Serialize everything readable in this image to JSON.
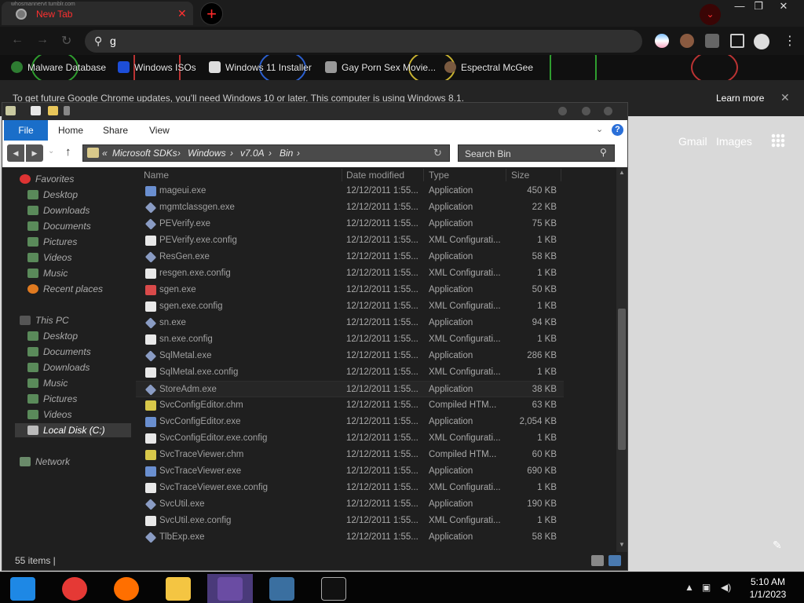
{
  "browser": {
    "tab": {
      "title": "New Tab",
      "close": "✕",
      "watermark": "whosmannervt tumblr.com"
    },
    "new_tab": "+",
    "window_controls": {
      "minimize": "—",
      "maximize": "❐",
      "close": "✕"
    },
    "tab_search": "⌄",
    "omnibox_text": "g",
    "bookmarks": [
      {
        "label": "Malware Database",
        "icon": "skull-icon",
        "color": "#4caf50"
      },
      {
        "label": "Windows ISOs",
        "icon": "x-logo-icon",
        "color": "#1d4ed8"
      },
      {
        "label": "Windows 11 Installer",
        "icon": "page-icon",
        "color": "#cccccc"
      },
      {
        "label": "Gay Porn Sex Movie...",
        "icon": "site-icon",
        "color": "#9e9e9e"
      },
      {
        "label": "Espectral McGee",
        "icon": "avatar-icon",
        "color": "#7a5a40"
      }
    ],
    "infobar": {
      "message": "To get future Google Chrome updates, you'll need Windows 10 or later. This computer is using Windows 8.1.",
      "learn_more": "Learn more",
      "close": "✕"
    },
    "page": {
      "gmail": "Gmail",
      "images": "Images"
    }
  },
  "explorer": {
    "ribbon_tabs": {
      "file": "File",
      "home": "Home",
      "share": "Share",
      "view": "View"
    },
    "help": "?",
    "breadcrumbs": [
      "«",
      "Microsoft SDKs",
      "›",
      "Windows",
      "›",
      "v7.0A",
      "›",
      "Bin",
      "›"
    ],
    "search_placeholder": "Search Bin",
    "nav_pane": {
      "favorites": "Favorites",
      "favorites_items": [
        "Desktop",
        "Downloads",
        "Documents",
        "Pictures",
        "Videos",
        "Music",
        "Recent places"
      ],
      "this_pc": "This PC",
      "this_pc_items": [
        "Desktop",
        "Documents",
        "Downloads",
        "Music",
        "Pictures",
        "Videos",
        "Local Disk (C:)"
      ],
      "network": "Network"
    },
    "columns": {
      "name": "Name",
      "date": "Date modified",
      "type": "Type",
      "size": "Size"
    },
    "files": [
      {
        "name": "mageui.exe",
        "date": "12/12/2011 1:55...",
        "type": "Application",
        "size": "450 KB",
        "icon": "app-window-icon"
      },
      {
        "name": "mgmtclassgen.exe",
        "date": "12/12/2011 1:55...",
        "type": "Application",
        "size": "22 KB",
        "icon": "exe-diamond-icon"
      },
      {
        "name": "PEVerify.exe",
        "date": "12/12/2011 1:55...",
        "type": "Application",
        "size": "75 KB",
        "icon": "exe-diamond-icon"
      },
      {
        "name": "PEVerify.exe.config",
        "date": "12/12/2011 1:55...",
        "type": "XML Configurati...",
        "size": "1 KB",
        "icon": "config-file-icon"
      },
      {
        "name": "ResGen.exe",
        "date": "12/12/2011 1:55...",
        "type": "Application",
        "size": "58 KB",
        "icon": "exe-diamond-icon"
      },
      {
        "name": "resgen.exe.config",
        "date": "12/12/2011 1:55...",
        "type": "XML Configurati...",
        "size": "1 KB",
        "icon": "config-file-icon"
      },
      {
        "name": "sgen.exe",
        "date": "12/12/2011 1:55...",
        "type": "Application",
        "size": "50 KB",
        "icon": "color-grid-icon"
      },
      {
        "name": "sgen.exe.config",
        "date": "12/12/2011 1:55...",
        "type": "XML Configurati...",
        "size": "1 KB",
        "icon": "config-file-icon"
      },
      {
        "name": "sn.exe",
        "date": "12/12/2011 1:55...",
        "type": "Application",
        "size": "94 KB",
        "icon": "exe-diamond-icon"
      },
      {
        "name": "sn.exe.config",
        "date": "12/12/2011 1:55...",
        "type": "XML Configurati...",
        "size": "1 KB",
        "icon": "config-file-icon"
      },
      {
        "name": "SqlMetal.exe",
        "date": "12/12/2011 1:55...",
        "type": "Application",
        "size": "286 KB",
        "icon": "exe-diamond-icon"
      },
      {
        "name": "SqlMetal.exe.config",
        "date": "12/12/2011 1:55...",
        "type": "XML Configurati...",
        "size": "1 KB",
        "icon": "config-file-icon"
      },
      {
        "name": "StoreAdm.exe",
        "date": "12/12/2011 1:55...",
        "type": "Application",
        "size": "38 KB",
        "icon": "exe-diamond-icon"
      },
      {
        "name": "SvcConfigEditor.chm",
        "date": "12/12/2011 1:55...",
        "type": "Compiled HTM...",
        "size": "63 KB",
        "icon": "help-file-icon"
      },
      {
        "name": "SvcConfigEditor.exe",
        "date": "12/12/2011 1:55...",
        "type": "Application",
        "size": "2,054 KB",
        "icon": "app-window-icon"
      },
      {
        "name": "SvcConfigEditor.exe.config",
        "date": "12/12/2011 1:55...",
        "type": "XML Configurati...",
        "size": "1 KB",
        "icon": "config-file-icon"
      },
      {
        "name": "SvcTraceViewer.chm",
        "date": "12/12/2011 1:55...",
        "type": "Compiled HTM...",
        "size": "60 KB",
        "icon": "help-file-icon"
      },
      {
        "name": "SvcTraceViewer.exe",
        "date": "12/12/2011 1:55...",
        "type": "Application",
        "size": "690 KB",
        "icon": "app-window-icon"
      },
      {
        "name": "SvcTraceViewer.exe.config",
        "date": "12/12/2011 1:55...",
        "type": "XML Configurati...",
        "size": "1 KB",
        "icon": "config-file-icon"
      },
      {
        "name": "SvcUtil.exe",
        "date": "12/12/2011 1:55...",
        "type": "Application",
        "size": "190 KB",
        "icon": "exe-diamond-icon"
      },
      {
        "name": "SvcUtil.exe.config",
        "date": "12/12/2011 1:55...",
        "type": "XML Configurati...",
        "size": "1 KB",
        "icon": "config-file-icon"
      },
      {
        "name": "TlbExp.exe",
        "date": "12/12/2011 1:55...",
        "type": "Application",
        "size": "58 KB",
        "icon": "exe-diamond-icon"
      }
    ],
    "status": "55 items  |"
  },
  "taskbar": {
    "apps": [
      "windows-explorer-icon",
      "chrome-icon",
      "firefox-icon",
      "file-explorer-icon",
      "people-icon",
      "photos-icon",
      "cmd-icon"
    ],
    "time": "5:10 AM",
    "date": "1/1/2023"
  }
}
